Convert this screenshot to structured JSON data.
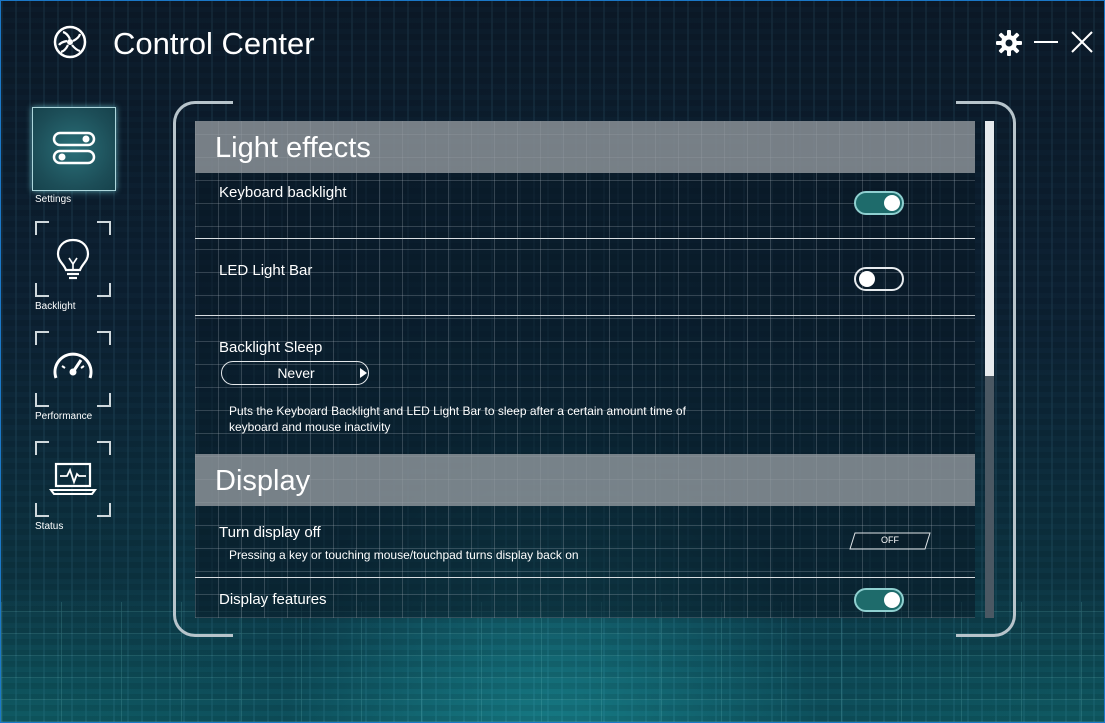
{
  "window": {
    "title": "Control Center",
    "logo_icon": "fan-wheel-icon",
    "controls": [
      "gear-icon",
      "minimize-icon",
      "close-icon"
    ]
  },
  "sidebar": {
    "items": [
      {
        "label": "Settings",
        "icon": "toggles-icon",
        "active": true
      },
      {
        "label": "Backlight",
        "icon": "lightbulb-icon",
        "active": false
      },
      {
        "label": "Performance",
        "icon": "speedometer-icon",
        "active": false
      },
      {
        "label": "Status",
        "icon": "laptop-pulse-icon",
        "active": false
      }
    ]
  },
  "sections": {
    "light_effects": {
      "title": "Light effects",
      "keyboard_backlight": {
        "label": "Keyboard backlight",
        "on": true
      },
      "led_light_bar": {
        "label": "LED Light Bar",
        "on": false
      },
      "backlight_sleep": {
        "label": "Backlight Sleep",
        "value": "Never",
        "description_line1": "Puts the Keyboard Backlight and LED Light Bar to sleep after a certain amount time of",
        "description_line2": "keyboard and mouse inactivity"
      }
    },
    "display": {
      "title": "Display",
      "turn_display_off": {
        "label": "Turn display off",
        "description": "Pressing a key or touching mouse/touchpad turns display back on",
        "button": "OFF"
      },
      "display_features": {
        "label": "Display features",
        "on": true
      }
    }
  },
  "colors": {
    "toggle_on": "#1e6b6b",
    "header_bar": "#969ca2",
    "window_border": "#1b78c7"
  },
  "scrollbar": {
    "position": 0
  }
}
